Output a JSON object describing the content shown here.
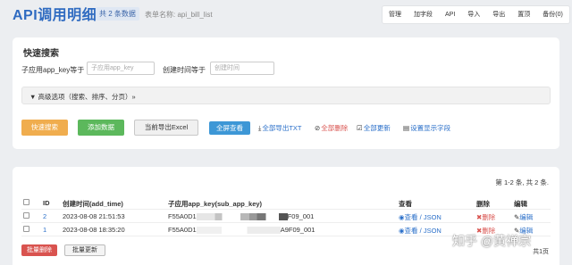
{
  "header": {
    "title": "API调用明细",
    "count_badge": "共 2 条数据",
    "table_name": "表单名称: api_bill_list",
    "menu": [
      "管理",
      "加字段",
      "API",
      "导入",
      "导出",
      "置顶",
      "备份(0)"
    ]
  },
  "search": {
    "title": "快速搜索",
    "field1_label": "子应用app_key等于",
    "field1_placeholder": "子应用app_key",
    "field2_label": "创建时间等于",
    "field2_placeholder": "创建时间",
    "advanced": "高级选项（搜索、排序、分页）»",
    "buttons": {
      "quick_search": "快速搜索",
      "add": "添加数据",
      "export_page": "当前导出Excel",
      "fullscreen": "全屏查看"
    },
    "links": {
      "export_txt": "全部导出TXT",
      "delete_all": "全部删除",
      "update_all": "全部更新",
      "set_fields": "设置显示字段"
    }
  },
  "results": {
    "pager_info": "第 1-2 条, 共 2 条.",
    "columns": [
      "ID",
      "创建时间(add_time)",
      "子应用app_key(sub_app_key)",
      "查看",
      "删除",
      "编辑"
    ],
    "rows": [
      {
        "id": "2",
        "time": "2023-08-08 21:51:53",
        "key_prefix": "F55A0D1",
        "key_suffix": "F09_001",
        "view": "查看",
        "json": "JSON",
        "del": "删除",
        "edit": "编辑"
      },
      {
        "id": "1",
        "time": "2023-08-08 18:35:20",
        "key_prefix": "F55A0D1",
        "key_suffix": "A9F09_001",
        "view": "查看",
        "json": "JSON",
        "del": "删除",
        "edit": "编辑"
      }
    ],
    "batch_delete": "批量删除",
    "batch_update": "批量更新",
    "page_label": "共1页"
  },
  "watermark": "知乎 @黄禅宗"
}
